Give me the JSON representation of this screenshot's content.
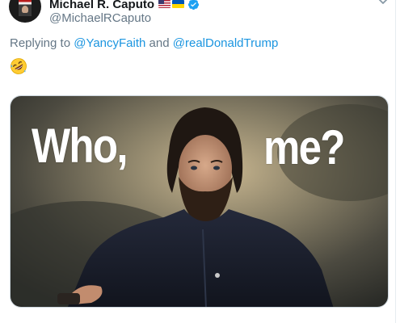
{
  "author": {
    "display_name": "Michael R. Caputo",
    "handle": "@MichaelRCaputo",
    "avatar_icon": "book-cover-avatar",
    "flags": [
      "us-flag-icon",
      "ukraine-flag-icon"
    ],
    "verified": true
  },
  "reply": {
    "prefix": "Replying to ",
    "mentions": [
      "@YancyFaith",
      "@realDonaldTrump"
    ],
    "conjunction": " and "
  },
  "tweet": {
    "emoji": "rolling-on-floor-laughing-emoji"
  },
  "media": {
    "caption_left": "Who,",
    "caption_right": "me?"
  },
  "colors": {
    "name": "#14171a",
    "secondary": "#657786",
    "link": "#1b95e0",
    "verified": "#1da1f2",
    "border": "#ccd6dd"
  }
}
